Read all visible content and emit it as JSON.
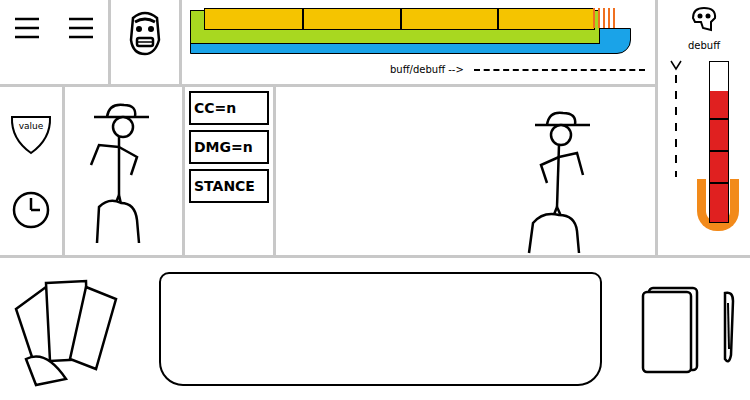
{
  "hud": {
    "value_label": "value",
    "buff_label": "buff/debuff -->",
    "debuff_label": "debuff"
  },
  "player_bars": [
    {
      "level": 0.86,
      "color": "#f5c400",
      "segments": 4
    },
    {
      "level": 0.9,
      "color": "#a8d820",
      "segments": 1
    },
    {
      "level": 0.97,
      "color": "#1aa3e8",
      "segments": 1
    }
  ],
  "stats": [
    {
      "label": "CC=n"
    },
    {
      "label": "DMG=n"
    },
    {
      "label": "STANCE"
    }
  ],
  "debuff_meter": {
    "level": 0.82,
    "color": "#e02020"
  }
}
